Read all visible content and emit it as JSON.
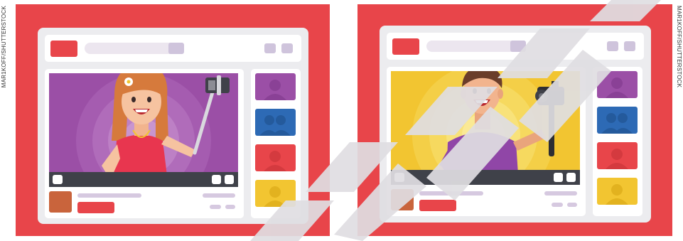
{
  "credit": {
    "left": "MAR1KOFF/SHUTTERSTOCK",
    "right": "MAR1KOFF/SHUTTERSTOCK"
  },
  "colors": {
    "frame_red": "#e8454a",
    "window_grey": "#ececef",
    "video_left_bg": "#9b4fa6",
    "video_right_bg": "#f2c531",
    "thumb_purple": "#9b4fa6",
    "thumb_blue": "#2d6ab5",
    "thumb_red": "#e8454a",
    "thumb_yellow": "#f2c531",
    "watermark": "#e0dee2"
  },
  "scenes": [
    {
      "subject": "woman-vlogger-with-selfie-stick",
      "thumbnails": [
        "purple",
        "blue",
        "red",
        "yellow"
      ]
    },
    {
      "subject": "man-vlogger-with-camera-gimbal",
      "thumbnails": [
        "purple",
        "blue",
        "red",
        "yellow"
      ]
    }
  ]
}
